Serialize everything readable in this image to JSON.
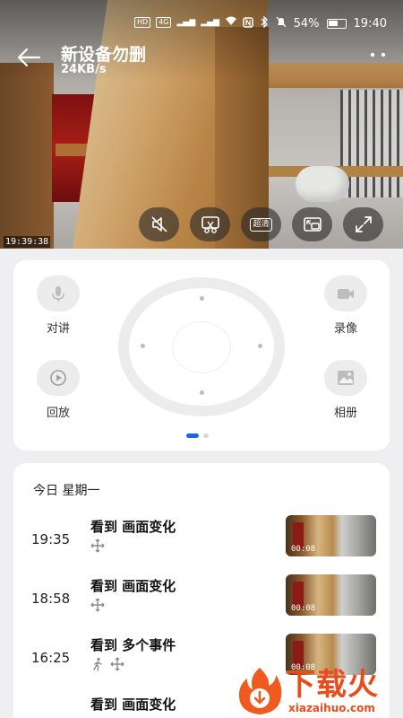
{
  "status_bar": {
    "time": "19:40",
    "battery": "54%",
    "left_chips": [
      "HD",
      "4G"
    ]
  },
  "header": {
    "title": "新设备勿删",
    "bitrate": "24KB/s",
    "timestamp": "19:39:38"
  },
  "video_controls": {
    "hd_label": "超清",
    "items": [
      "mute-icon",
      "screenshot-icon",
      "quality-icon",
      "pip-icon",
      "fullscreen-icon"
    ]
  },
  "actions": {
    "talk": "对讲",
    "record": "录像",
    "playback": "回放",
    "album": "相册"
  },
  "pager": {
    "pages": 2,
    "current": 1
  },
  "events": {
    "day": "今日  星期一",
    "items": [
      {
        "time": "19:35",
        "title": "看到 画面变化",
        "icons": [
          "move-icon"
        ],
        "duration": "00:08"
      },
      {
        "time": "18:58",
        "title": "看到 画面变化",
        "icons": [
          "move-icon"
        ],
        "duration": "00:08"
      },
      {
        "time": "16:25",
        "title": "看到 多个事件",
        "icons": [
          "person-walk-icon",
          "move-icon"
        ],
        "duration": "00:08"
      },
      {
        "time": "",
        "title": "看到 画面变化",
        "icons": [],
        "duration": ""
      }
    ]
  },
  "watermark": {
    "text": "下载火",
    "url": "xiazaihuo.com"
  }
}
